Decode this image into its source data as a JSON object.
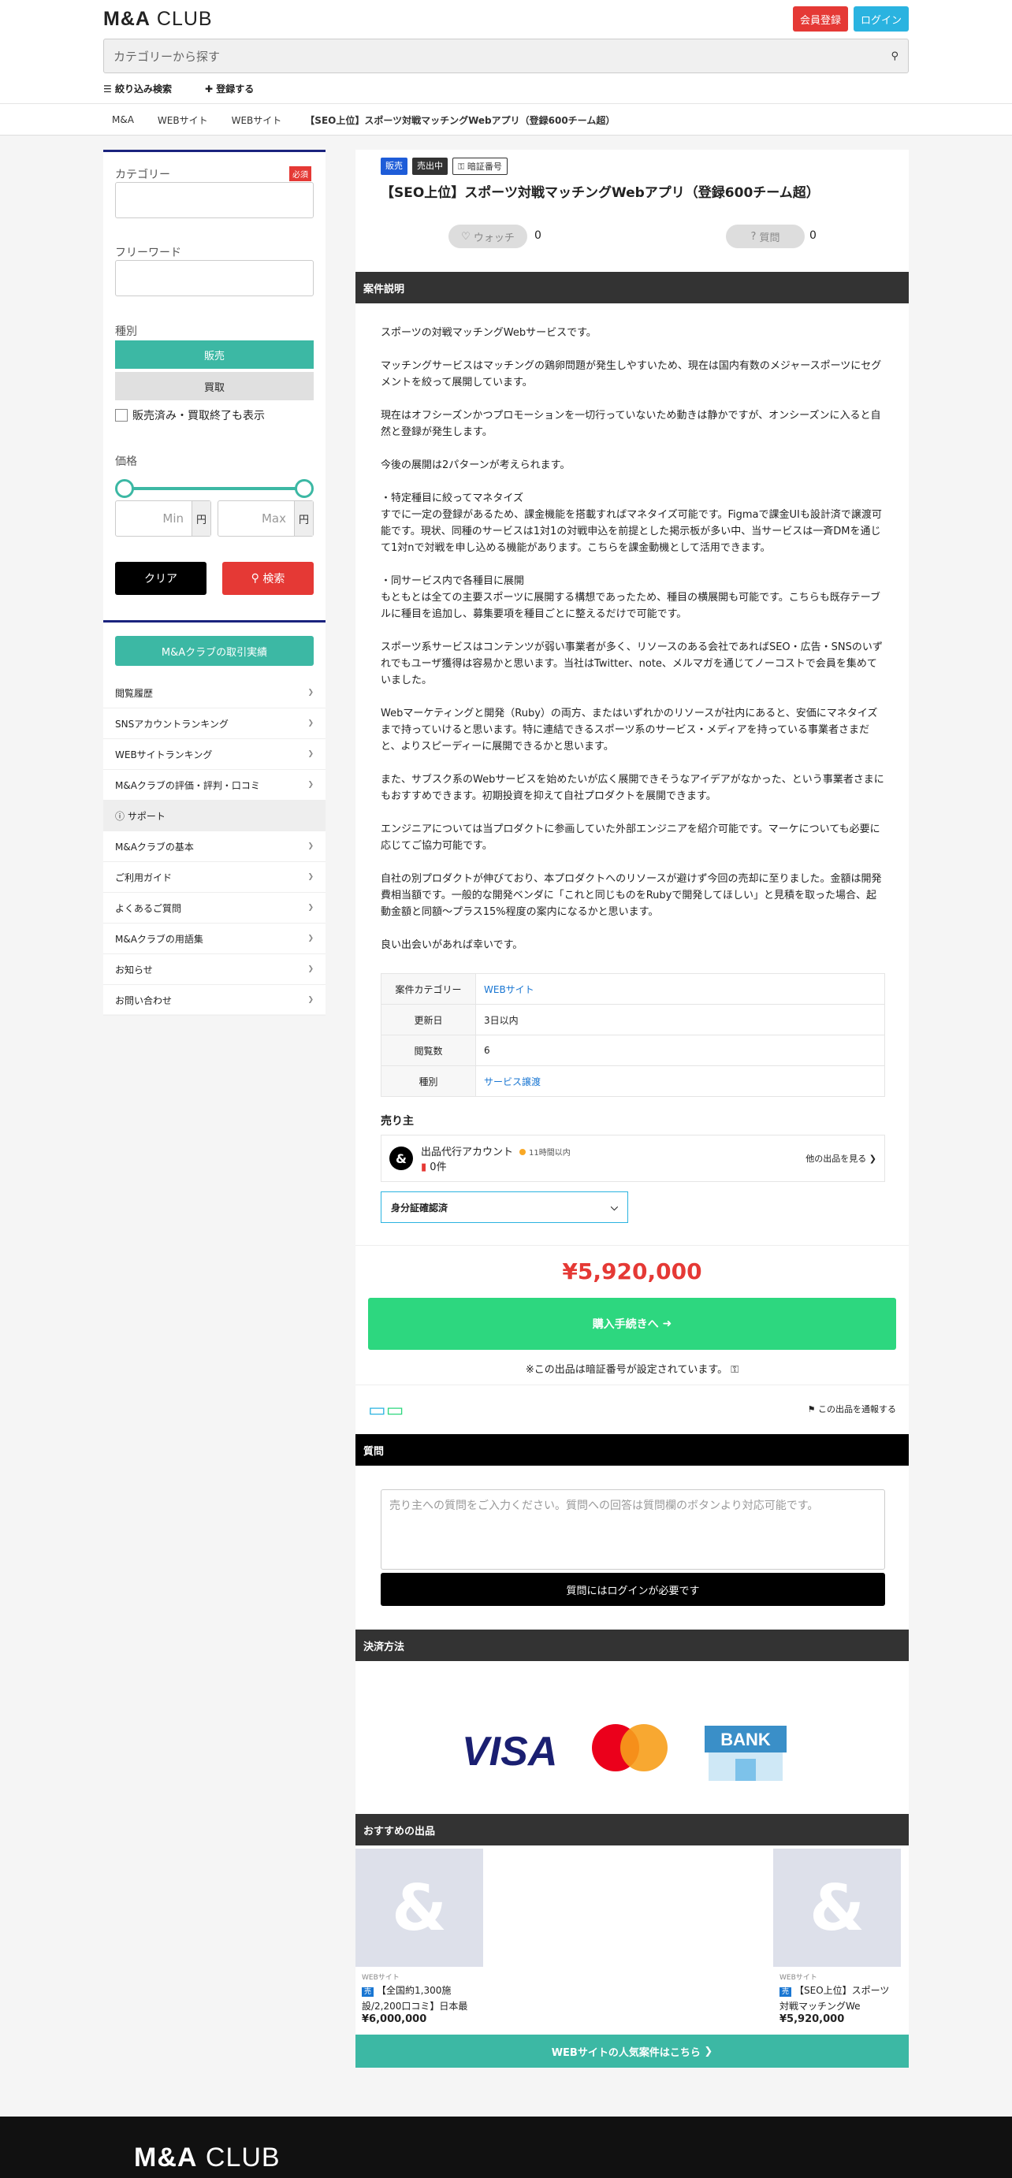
{
  "header": {
    "logo_bold": "M&A",
    "logo_light": "CLUB",
    "register_label": "会員登録",
    "login_label": "ログイン",
    "search_placeholder": "カテゴリーから探す",
    "filter_label": "絞り込み検索",
    "register_item_label": "登録する"
  },
  "breadcrumb": [
    "M&A",
    "WEBサイト",
    "WEBサイト",
    "【SEO上位】スポーツ対戦マッチングWebアプリ（登録600チーム超）"
  ],
  "filters": {
    "category_label": "カテゴリー",
    "required_badge": "必須",
    "freeword_label": "フリーワード",
    "type_label": "種別",
    "type_sell": "販売",
    "type_buy": "買取",
    "include_closed": "販売済み・買取終了も表示",
    "price_label": "価格",
    "min_placeholder": "Min",
    "max_placeholder": "Max",
    "yen": "円",
    "clear_label": "クリア",
    "search_label": "検索"
  },
  "sidebar": {
    "deals_button": "M&Aクラブの取引実績",
    "items": [
      "閲覧履歴",
      "SNSアカウントランキング",
      "WEBサイトランキング",
      "M&Aクラブの評価・評判・口コミ",
      "サポート",
      "M&Aクラブの基本",
      "ご利用ガイド",
      "よくあるご質問",
      "M&Aクラブの用語集",
      "お知らせ",
      "お問い合わせ"
    ]
  },
  "listing": {
    "badge_sell": "販売",
    "badge_status": "売出中",
    "badge_secret": "暗証番号",
    "title": "【SEO上位】スポーツ対戦マッチングWebアプリ（登録600チーム超）",
    "watch_label": "ウォッチ",
    "watch_count": "0",
    "question_label": "質問",
    "question_count": "0",
    "section_description": "案件説明",
    "description": [
      "スポーツの対戦マッチングWebサービスです。",
      "マッチングサービスはマッチングの鶏卵問題が発生しやすいため、現在は国内有数のメジャースポーツにセグメントを絞って展開しています。",
      "現在はオフシーズンかつプロモーションを一切行っていないため動きは静かですが、オンシーズンに入ると自然と登録が発生します。",
      "今後の展開は2パターンが考えられます。",
      "・特定種目に絞ってマネタイズ\nすでに一定の登録があるため、課金機能を搭載すればマネタイズ可能です。Figmaで課金UIも設計済で譲渡可能です。現状、同種のサービスは1対1の対戦申込を前提とした掲示板が多い中、当サービスは一斉DMを通じて1対nで対戦を申し込める機能があります。こちらを課金動機として活用できます。",
      "・同サービス内で各種目に展開\nもともとは全ての主要スポーツに展開する構想であったため、種目の横展開も可能です。こちらも既存テーブルに種目を追加し、募集要項を種目ごとに整えるだけで可能です。",
      "スポーツ系サービスはコンテンツが弱い事業者が多く、リソースのある会社であればSEO・広告・SNSのいずれでもユーザ獲得は容易かと思います。当社はTwitter、note、メルマガを通じてノーコストで会員を集めていました。",
      "Webマーケティングと開発（Ruby）の両方、またはいずれかのリソースが社内にあると、安価にマネタイズまで持っていけると思います。特に連結できるスポーツ系のサービス・メディアを持っている事業者さまだと、よりスピーディーに展開できるかと思います。",
      "また、サブスク系のWebサービスを始めたいが広く展開できそうなアイデアがなかった、という事業者さまにもおすすめできます。初期投資を抑えて自社プロダクトを展開できます。",
      "エンジニアについては当プロダクトに参画していた外部エンジニアを紹介可能です。マーケについても必要に応じてご協力可能です。",
      "自社の別プロダクトが伸びており、本プロダクトへのリソースが避けず今回の売却に至りました。金額は開発費相当額です。一般的な開発ベンダに「これと同じものをRubyで開発してほしい」と見積を取った場合、起動金額と同額〜プラス15%程度の案内になるかと思います。",
      "良い出会いがあれば幸いです。"
    ],
    "info": [
      {
        "key": "案件カテゴリー",
        "value": "WEBサイト",
        "link": true
      },
      {
        "key": "更新日",
        "value": "3日以内",
        "link": false
      },
      {
        "key": "閲覧数",
        "value": "6",
        "link": false
      },
      {
        "key": "種別",
        "value": "サービス譲渡",
        "link": true
      }
    ],
    "seller_heading": "売り主",
    "seller_name": "出品代行アカウント",
    "seller_active": "11時間以内",
    "seller_items": "0件",
    "seller_other": "他の出品を見る",
    "id_verify": "身分証確認済",
    "price": "¥5,920,000",
    "buy_label": "購入手続きへ",
    "secret_note": "※この出品は暗証番号が設定されています。",
    "report_label": "この出品を通報する",
    "section_question": "質問",
    "question_placeholder": "売り主への質問をご入力ください。質問への回答は質問欄のボタンより対応可能です。",
    "question_login": "質問にはログインが必要です",
    "section_payment": "決済方法",
    "pay_visa": "VISA",
    "pay_bank": "BANK",
    "section_reco": "おすすめの出品",
    "reco": [
      {
        "cat": "WEBサイト",
        "badge": "売",
        "title": "【全国約1,300施設/2,200口コミ】日本最",
        "price": "¥6,000,000"
      },
      {
        "cat": "WEBサイト",
        "badge": "売",
        "title": "【SEO上位】スポーツ対戦マッチングWe",
        "price": "¥5,920,000"
      }
    ],
    "popular_label": "WEBサイトの人気案件はこちら"
  },
  "footer": {
    "logo_bold": "M&A",
    "logo_light": "CLUB"
  },
  "colors": {
    "accent": "#3cb8a4",
    "red": "#e53935",
    "buy": "#2dd77f",
    "navy": "#1a237e"
  }
}
